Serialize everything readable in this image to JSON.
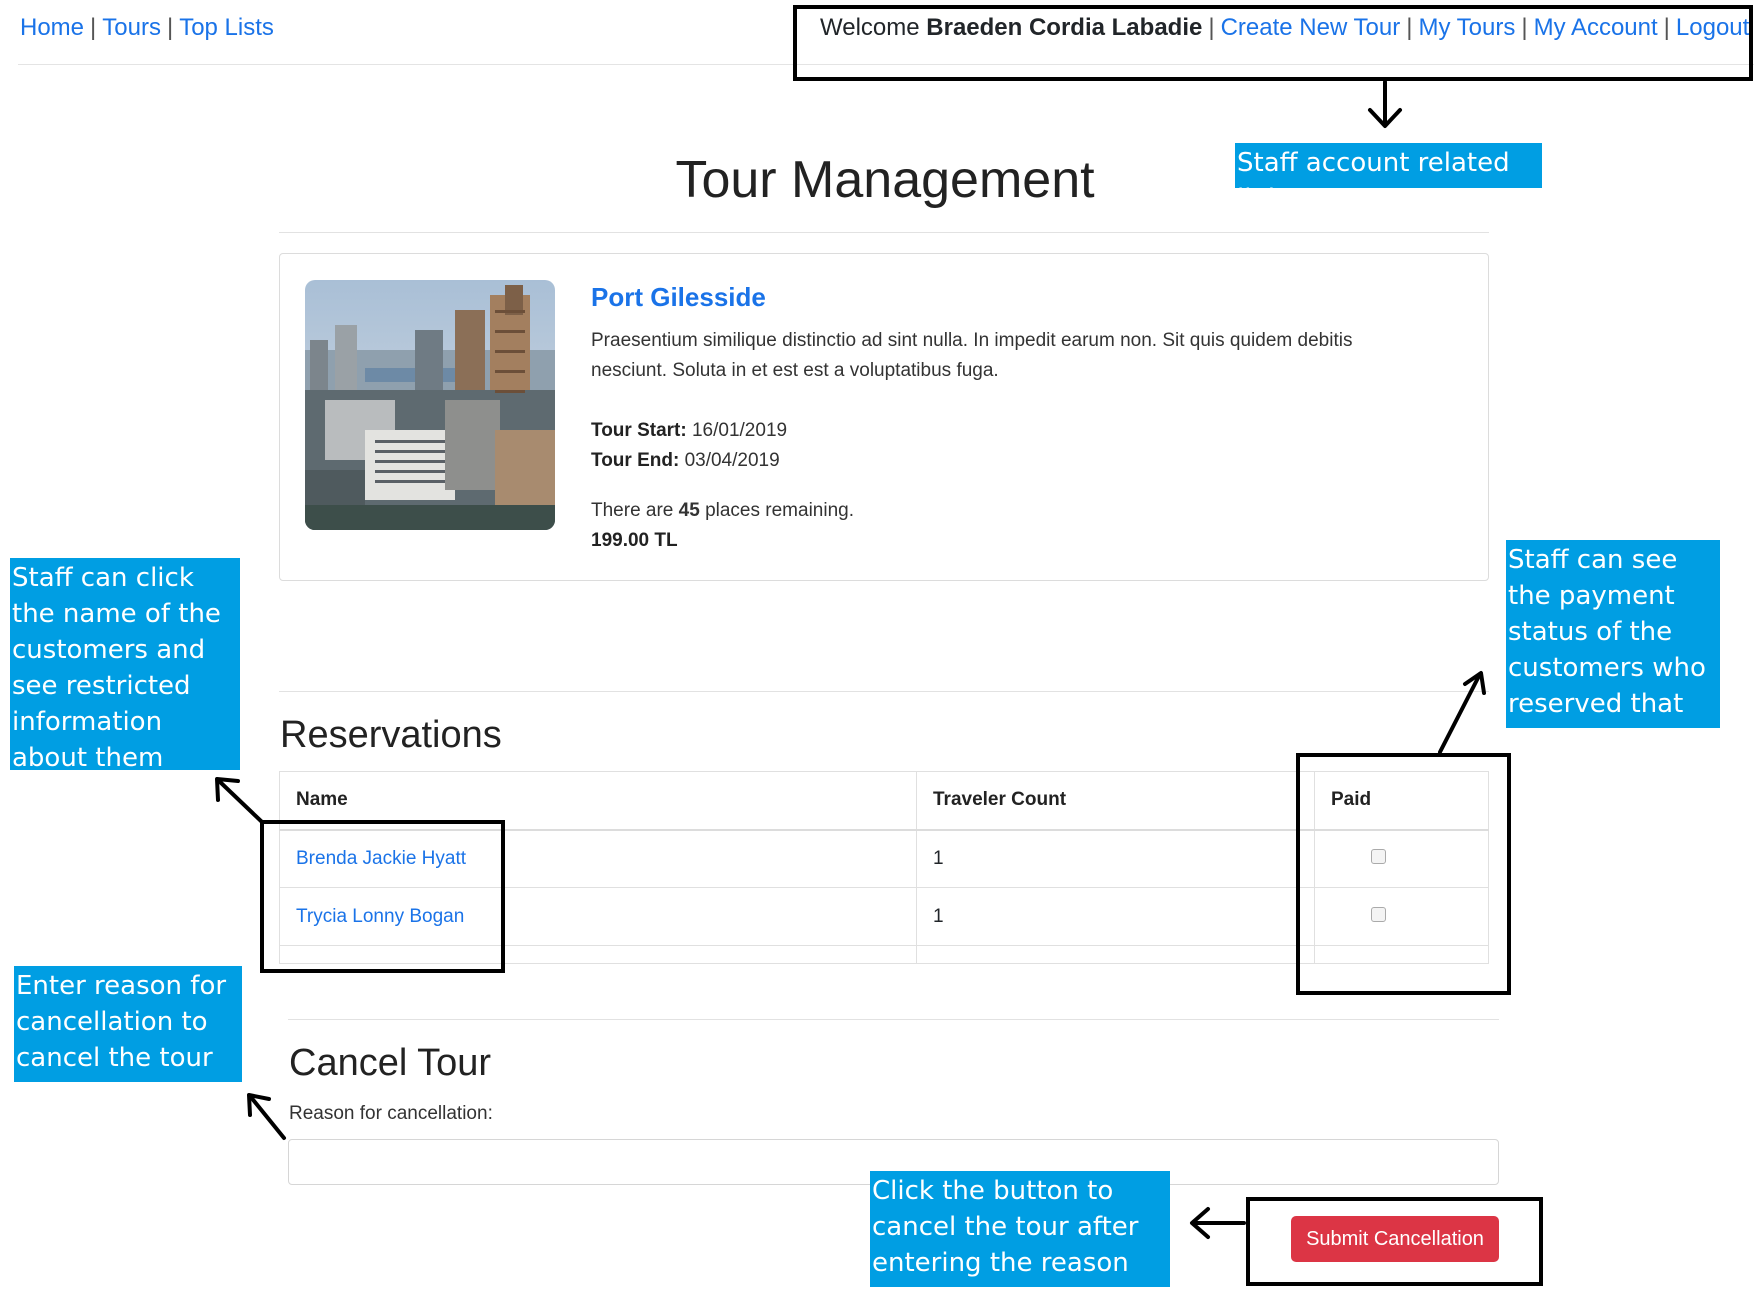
{
  "nav": {
    "left": [
      "Home",
      "Tours",
      "Top Lists"
    ],
    "welcome_prefix": "Welcome",
    "user_name": "Braeden Cordia Labadie",
    "right": [
      "Create New Tour",
      "My Tours",
      "My Account",
      "Logout"
    ],
    "separator": "|"
  },
  "page_title": "Tour Management",
  "tour": {
    "name": "Port Gilesside",
    "description": "Praesentium similique distinctio ad sint nulla. In impedit earum non. Sit quis quidem debitis nesciunt. Soluta in et est est a voluptatibus fuga.",
    "start_label": "Tour Start:",
    "start": "16/01/2019",
    "end_label": "Tour End:",
    "end": "03/04/2019",
    "places_prefix": "There are",
    "places_remaining": "45",
    "places_suffix": "places remaining.",
    "price": "199.00 TL"
  },
  "reservations": {
    "title": "Reservations",
    "columns": [
      "Name",
      "Traveler Count",
      "Paid"
    ],
    "rows": [
      {
        "name": "Brenda Jackie Hyatt",
        "traveler_count": "1",
        "paid": false
      },
      {
        "name": "Trycia Lonny Bogan",
        "traveler_count": "1",
        "paid": false
      }
    ]
  },
  "cancel": {
    "title": "Cancel Tour",
    "reason_label": "Reason for cancellation:",
    "reason_value": "",
    "submit_label": "Submit Cancellation"
  },
  "annotations": {
    "account_links": "Staff account related links",
    "customer_names": "Staff can click the name of the customers and see restricted information about them",
    "payment_status": "Staff can see the payment status of the customers who reserved that tour",
    "cancel_reason": "Enter reason for cancellation to cancel the tour",
    "submit_button": "Click the button to cancel the tour after entering the reason"
  },
  "colors": {
    "link": "#1a73e8",
    "callout_bg": "#009ee3",
    "danger": "#dc3545"
  }
}
